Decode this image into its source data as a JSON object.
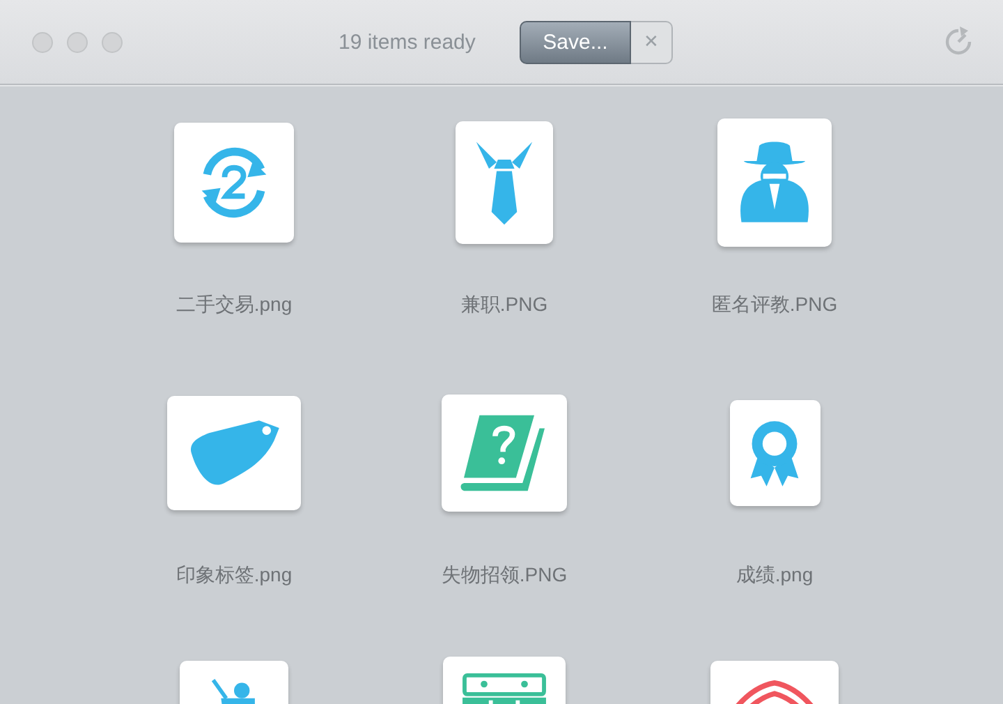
{
  "window": {
    "status": "19 items ready",
    "save_button": "Save...",
    "dismiss_button": "✕"
  },
  "items": [
    {
      "label": "二手交易.png",
      "kind": "swap-two"
    },
    {
      "label": "兼职.PNG",
      "kind": "tie"
    },
    {
      "label": "匿名评教.PNG",
      "kind": "spy"
    },
    {
      "label": "印象标签.png",
      "kind": "tag"
    },
    {
      "label": "失物招领.PNG",
      "kind": "book"
    },
    {
      "label": "成绩.png",
      "kind": "ribbon"
    },
    {
      "kind": "teacher"
    },
    {
      "kind": "table"
    },
    {
      "kind": "arc"
    }
  ]
}
